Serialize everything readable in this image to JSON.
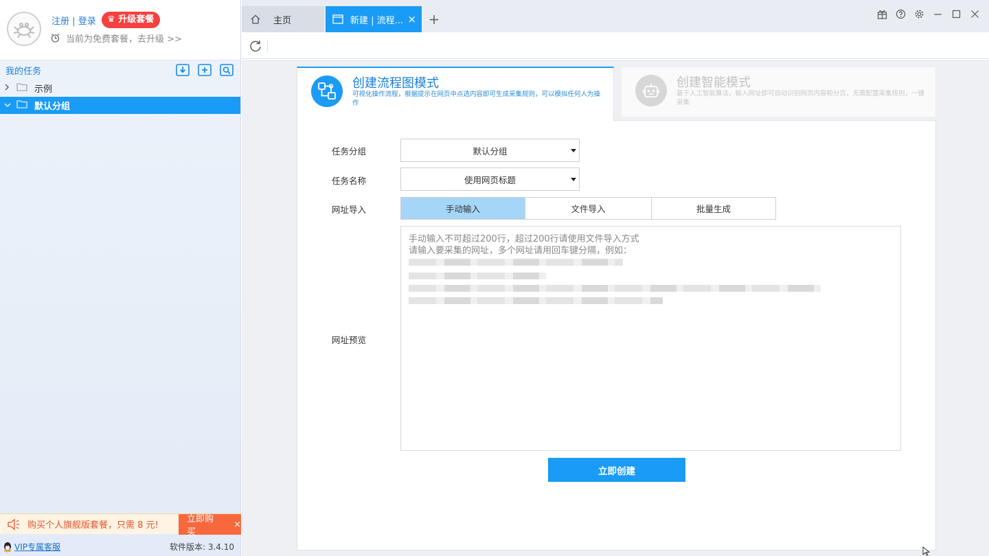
{
  "user": {
    "register_label": "注册",
    "separator": "|",
    "login_label": "登录",
    "upgrade_label": "升级套餐",
    "plan_text": "当前为免费套餐，去升级 >>"
  },
  "tasks": {
    "title": "我的任务",
    "tools": [
      "import-task-icon",
      "add-task-icon",
      "search-task-icon"
    ],
    "items": [
      {
        "label": "示例",
        "expanded": false,
        "selected": false
      },
      {
        "label": "默认分组",
        "expanded": true,
        "selected": true
      }
    ]
  },
  "promo": {
    "text": "购买个人旗舰版套餐，只需 8 元!",
    "buy_label": "立即购买",
    "close_label": "×"
  },
  "footer": {
    "vip_label": "VIP专属客服",
    "version": "软件版本: 3.4.10"
  },
  "tabs": {
    "home_label": "主页",
    "new_label": "新建 | 流程...",
    "close_label": "×",
    "add_label": "+"
  },
  "modes": {
    "flow": {
      "title": "创建流程图模式",
      "desc": "可视化操作流程，根据提示在网页中点选内容即可生成采集规则，可以模拟任何人为操作"
    },
    "smart": {
      "title": "创建智能模式",
      "desc": "基于人工智能算法，输入网址即可自动识别网页内容和分页，无需配置采集规则，一键采集"
    }
  },
  "form": {
    "group_label": "任务分组",
    "group_value": "默认分组",
    "name_label": "任务名称",
    "name_value": "使用网页标题",
    "url_label": "网址导入",
    "url_tabs": [
      "手动输入",
      "文件导入",
      "批量生成"
    ],
    "preview_label": "网址预览",
    "textarea_line1": "手动输入不可超过200行，超过200行请使用文件导入方式",
    "textarea_line2": "请输入要采集的网址，多个网址请用回车键分隔，例如：",
    "create_label": "立即创建"
  },
  "colors": {
    "accent": "#1a9bf5",
    "upgrade": "#f5413f",
    "promo": "#f8683c"
  }
}
